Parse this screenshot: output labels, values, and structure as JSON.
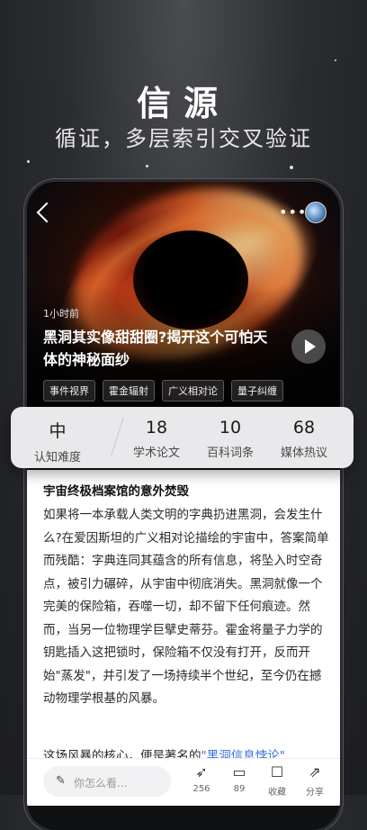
{
  "hero": {
    "title": "信源",
    "subtitle": "循证，多层索引交叉验证"
  },
  "post": {
    "time": "1小时前",
    "title": "黑洞其实像甜甜圈?揭开这个可怕天体的神秘面纱",
    "tags": [
      "事件视界",
      "霍金辐射",
      "广义相对论",
      "量子纠缠"
    ]
  },
  "stats": [
    {
      "value": "中",
      "label": "认知难度"
    },
    {
      "value": "18",
      "label": "学术论文"
    },
    {
      "value": "10",
      "label": "百科词条"
    },
    {
      "value": "68",
      "label": "媒体热议"
    }
  ],
  "article": {
    "heading": "宇宙终极档案馆的意外焚毁",
    "body": "如果将一本承载人类文明的字典扔进黑洞，会发生什么?在爱因斯坦的广义相对论描绘的宇宙中，答案简单而残酷：字典连同其蕴含的所有信息，将坠入时空奇点，被引力碾碎，从宇宙中彻底消失。黑洞就像一个完美的保险箱，吞噬一切，却不留下任何痕迹。然而，当另一位物理学巨擘史蒂芬。霍金将量子力学的钥匙插入这把锁时，保险箱不仅没有打开，反而开始\"蒸发\"，并引发了一场持续半个世纪，至今仍在撼动物理学根基的风暴。",
    "next_prefix": "这场风暴的核心，便是著名的",
    "next_link": "\"黑洞信息悖论\""
  },
  "bottom_bar": {
    "ask_placeholder": "你怎么看...",
    "actions": [
      {
        "icon": "rocket-icon",
        "label": "256"
      },
      {
        "icon": "comment-icon",
        "label": "89"
      },
      {
        "icon": "bookmark-icon",
        "label": "收藏"
      },
      {
        "icon": "share-icon",
        "label": "分享"
      }
    ]
  }
}
